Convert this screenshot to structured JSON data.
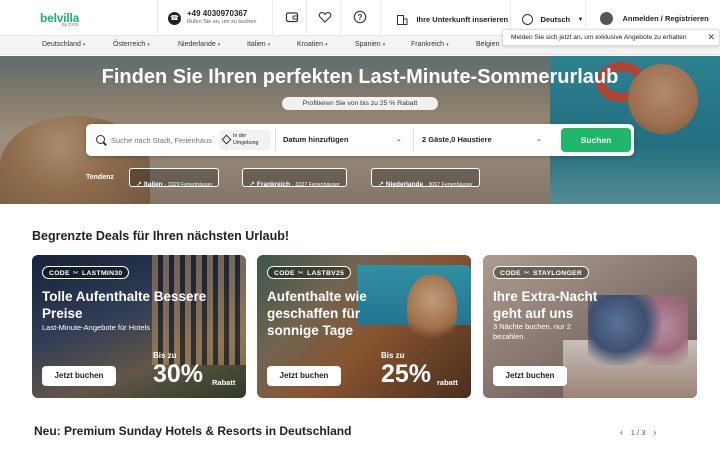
{
  "brand": {
    "name": "belvilla",
    "sub": "by OYO"
  },
  "header": {
    "phone_number": "+49 4030970367",
    "phone_hint": "Rufen Sie an, um zu buchen",
    "list_property": "Ihre Unterkunft inserieren",
    "language": "Deutsch",
    "login": "Anmelden / Registrieren"
  },
  "tooltip": {
    "text": "Melden Sie sich jetzt an, um exklusive Angebote zu erhalten",
    "close": "✕"
  },
  "countries": [
    "Deutschland",
    "Österreich",
    "Niederlande",
    "Italien",
    "Kroatien",
    "Spanien",
    "Frankreich",
    "Belgien"
  ],
  "hero": {
    "title": "Finden Sie Ihren perfekten Last-Minute-Sommerurlaub",
    "badge": "Profitieren Sie von bis zu 25 % Rabatt"
  },
  "search": {
    "placeholder": "Suche nach Stadt, Ferienhaus",
    "near_label": "In der Umgebung",
    "date_label": "Datum hinzufügen",
    "guests_label": "2 Gäste,0 Haustiere",
    "button_label": "Suchen"
  },
  "trends": {
    "label": "Tendenz",
    "items": [
      {
        "name": "Italien",
        "count": "· 3329 Ferienhäuser"
      },
      {
        "name": "Frankreich",
        "count": "· 3337 Ferienhäuser"
      },
      {
        "name": "Niederlande",
        "count": "· 3067 Ferienhäuser"
      }
    ]
  },
  "deals": {
    "title": "Begrenzte Deals für Ihren nächsten Urlaub!",
    "cards": [
      {
        "code_label": "CODE",
        "code": "LASTMIN30",
        "title": "Tolle Aufenthalte Bessere Preise",
        "subtitle": "Last-Minute-Angebote für Hotels",
        "button": "Jetzt buchen",
        "prefix": "Bis zu",
        "percent": "30%",
        "suffix": "Rabatt"
      },
      {
        "code_label": "CODE",
        "code": "LASTBV25",
        "title": "Aufenthalte wie geschaffen für sonnige Tage",
        "subtitle": "",
        "button": "Jetzt buchen",
        "prefix": "Bis zu",
        "percent": "25%",
        "suffix": "rabatt"
      },
      {
        "code_label": "CODE",
        "code": "STAYLONGER",
        "title": "Ihre Extra-Nacht geht auf uns",
        "subtitle": "3 Nächte buchen, nur 2 bezahlen.",
        "button": "Jetzt buchen",
        "prefix": "",
        "percent": "",
        "suffix": ""
      }
    ]
  },
  "premium": {
    "title": "Neu: Premium Sunday Hotels & Resorts in Deutschland",
    "pager": "1 / 3",
    "prev": "‹",
    "next": "›"
  },
  "icons": {
    "phone": "phone-icon",
    "wallet": "wallet-icon",
    "heart": "heart-icon",
    "help": "help-icon",
    "building": "building-icon",
    "globe": "globe-icon",
    "user": "user-icon",
    "search": "search-icon",
    "trend": "trend-up-icon",
    "scissors": "scissors-icon"
  },
  "colors": {
    "accent": "#1fb86a",
    "brand": "#1fb36b"
  }
}
